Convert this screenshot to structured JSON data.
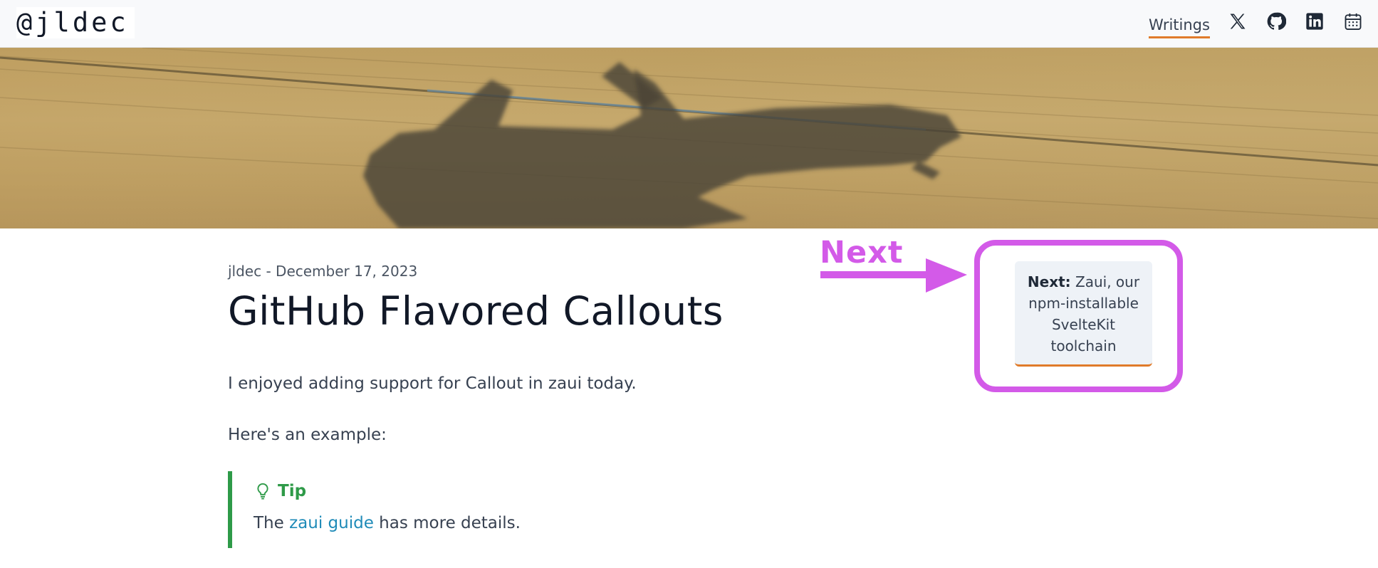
{
  "header": {
    "logo": "@jldec",
    "nav_writings": "Writings",
    "icons": [
      "x-icon",
      "github-icon",
      "linkedin-icon",
      "calendar-icon"
    ],
    "accent_color": "#e07b2a"
  },
  "hero": {
    "image": "airplane-shadow-over-field"
  },
  "post": {
    "meta": "jldec - December 17, 2023",
    "title": "GitHub Flavored Callouts",
    "para1": "I enjoyed adding support for Callout in zaui today.",
    "para2": "Here's an example:",
    "callout": {
      "label": "Tip",
      "text_before": "The ",
      "link": "zaui guide",
      "text_after": " has more details.",
      "color": "#2e9a48"
    }
  },
  "next": {
    "prefix": "Next:",
    "text": "Zaui, our npm-installable SvelteKit toolchain"
  },
  "annotation": {
    "label": "Next",
    "color": "#d35ae8"
  }
}
